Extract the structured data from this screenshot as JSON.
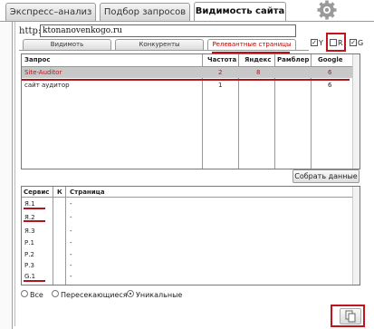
{
  "tabs": [
    {
      "label": "Экспресс–анализ"
    },
    {
      "label": "Подбор запросов"
    },
    {
      "label": "Видимость сайта"
    }
  ],
  "url": {
    "label": "http://",
    "value": "ktonanovenkogo.ru"
  },
  "subtabs": [
    {
      "label": "Видимоть"
    },
    {
      "label": "Конкуренты"
    },
    {
      "label": "Релевантные страницы"
    }
  ],
  "engines": [
    {
      "label": "Y",
      "checked": true
    },
    {
      "label": "R",
      "checked": false
    },
    {
      "label": "G",
      "checked": true
    }
  ],
  "queries": {
    "headers": [
      "Запрос",
      "Частота",
      "Яндекс",
      "Рамблер",
      "Google"
    ],
    "rows": [
      {
        "query": "Site-Auditor",
        "freq": "2",
        "yandex": "8",
        "rambler": "",
        "google": "6"
      },
      {
        "query": "сайт аудитор",
        "freq": "1",
        "yandex": "",
        "rambler": "",
        "google": "6"
      }
    ]
  },
  "collect_button": "Собрать данные",
  "pages": {
    "headers": [
      "Сервис",
      "К",
      "Страница"
    ],
    "rows": [
      {
        "service": "Я.1",
        "k": "",
        "page": "-"
      },
      {
        "service": "Я.2",
        "k": "",
        "page": "-"
      },
      {
        "service": "Я.3",
        "k": "",
        "page": "-"
      },
      {
        "service": "Р.1",
        "k": "",
        "page": "-"
      },
      {
        "service": "Р.2",
        "k": "",
        "page": "-"
      },
      {
        "service": "Р.3",
        "k": "",
        "page": "-"
      },
      {
        "service": "G.1",
        "k": "",
        "page": "-"
      }
    ]
  },
  "filters": [
    {
      "label": "Все",
      "selected": false
    },
    {
      "label": "Пересекающиеся",
      "selected": false
    },
    {
      "label": "Уникальные",
      "selected": true
    }
  ],
  "icons": {
    "settings": "gear-icon",
    "copy": "copy-icon"
  },
  "colors": {
    "accent": "#b3131b",
    "selected_row": "#c8c8c8"
  }
}
